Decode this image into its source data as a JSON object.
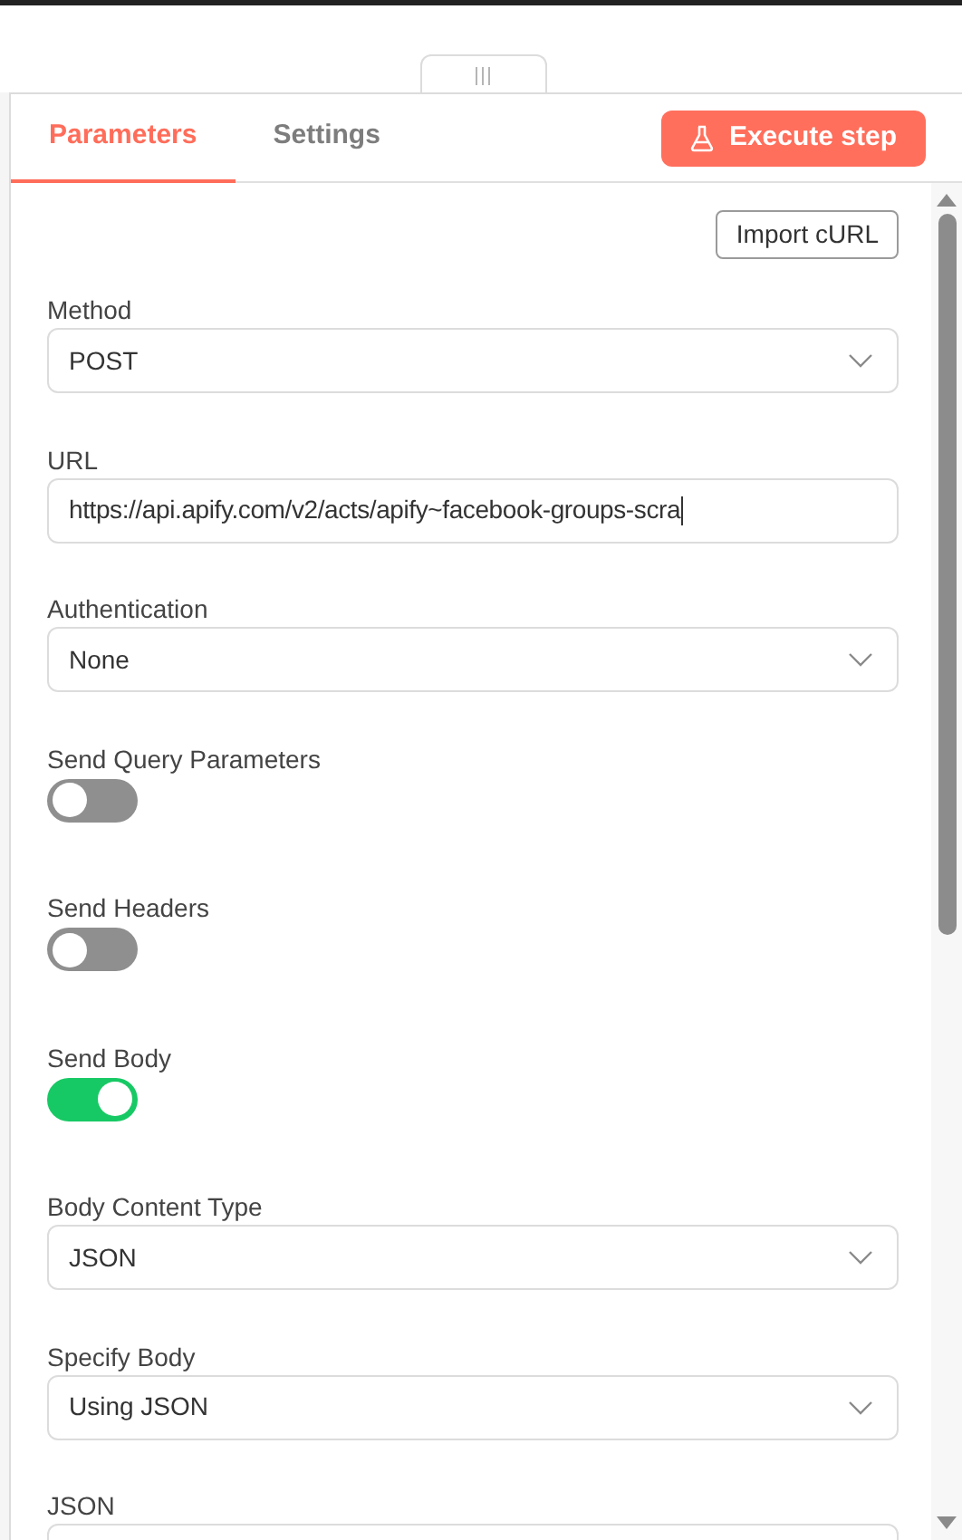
{
  "tabs": [
    {
      "label": "Parameters",
      "selected": true
    },
    {
      "label": "Settings",
      "selected": false
    }
  ],
  "execute_button": {
    "label": "Execute step"
  },
  "import_button": {
    "label": "Import cURL"
  },
  "fields": [
    {
      "kind": "select",
      "label": "Method",
      "value": "POST"
    },
    {
      "kind": "text",
      "label": "URL",
      "value": "https://api.apify.com/v2/acts/apify~facebook-groups-scra"
    },
    {
      "kind": "select",
      "label": "Authentication",
      "value": "None"
    },
    {
      "kind": "toggle",
      "label": "Send Query Parameters",
      "on": false
    },
    {
      "kind": "toggle",
      "label": "Send Headers",
      "on": false
    },
    {
      "kind": "toggle",
      "label": "Send Body",
      "on": true
    },
    {
      "kind": "select",
      "label": "Body Content Type",
      "value": "JSON"
    },
    {
      "kind": "select",
      "label": "Specify Body",
      "value": "Using JSON"
    },
    {
      "kind": "editor",
      "label": "JSON"
    }
  ]
}
